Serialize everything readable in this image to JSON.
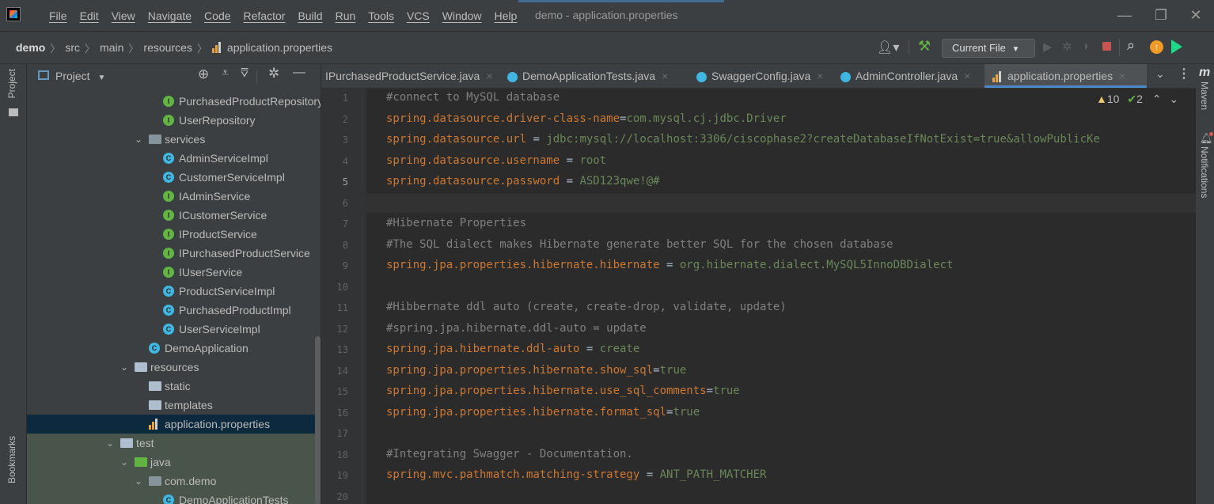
{
  "window": {
    "menu": [
      "File",
      "Edit",
      "View",
      "Navigate",
      "Code",
      "Refactor",
      "Build",
      "Run",
      "Tools",
      "VCS",
      "Window",
      "Help"
    ],
    "title": "demo - application.properties",
    "controls": {
      "minimize": "—",
      "restore": "❐",
      "close": "✕"
    }
  },
  "breadcrumb": [
    "demo",
    "src",
    "main",
    "resources",
    "application.properties"
  ],
  "toolbar": {
    "run_config": "Current File"
  },
  "stripes": {
    "left_top": "Project",
    "left_bottom": "Bookmarks",
    "right_maven": "Maven",
    "right_notifications": "Notifications"
  },
  "project_panel": {
    "title": "Project"
  },
  "tree": [
    {
      "label": "PurchasedProductRepository",
      "kind": "interface",
      "indent": 1
    },
    {
      "label": "UserRepository",
      "kind": "interface",
      "indent": 1
    },
    {
      "label": "services",
      "kind": "package",
      "indent": 0,
      "expanded": true
    },
    {
      "label": "AdminServiceImpl",
      "kind": "class",
      "indent": 1
    },
    {
      "label": "CustomerServiceImpl",
      "kind": "class",
      "indent": 1
    },
    {
      "label": "IAdminService",
      "kind": "interface",
      "indent": 1
    },
    {
      "label": "ICustomerService",
      "kind": "interface",
      "indent": 1
    },
    {
      "label": "IProductService",
      "kind": "interface",
      "indent": 1
    },
    {
      "label": "IPurchasedProductService",
      "kind": "interface",
      "indent": 1
    },
    {
      "label": "IUserService",
      "kind": "interface",
      "indent": 1
    },
    {
      "label": "ProductServiceImpl",
      "kind": "class",
      "indent": 1
    },
    {
      "label": "PurchasedProductImpl",
      "kind": "class",
      "indent": 1
    },
    {
      "label": "UserServiceImpl",
      "kind": "class",
      "indent": 1
    },
    {
      "label": "DemoApplication",
      "kind": "app",
      "indent": 0
    },
    {
      "label": "resources",
      "kind": "resources",
      "indent": -1,
      "expanded": true
    },
    {
      "label": "static",
      "kind": "folder",
      "indent": 0
    },
    {
      "label": "templates",
      "kind": "folder",
      "indent": 0
    },
    {
      "label": "application.properties",
      "kind": "properties",
      "indent": 0,
      "selected": true
    },
    {
      "label": "test",
      "kind": "folder",
      "indent": -2,
      "expanded": true
    },
    {
      "label": "java",
      "kind": "folder-green",
      "indent": -1,
      "expanded": true
    },
    {
      "label": "com.demo",
      "kind": "package",
      "indent": 0,
      "expanded": true
    },
    {
      "label": "DemoApplicationTests",
      "kind": "app",
      "indent": 1
    }
  ],
  "tabs": [
    {
      "label": "IPurchasedProductService.java"
    },
    {
      "label": "DemoApplicationTests.java"
    },
    {
      "label": "SwaggerConfig.java"
    },
    {
      "label": "AdminController.java"
    },
    {
      "label": "application.properties",
      "active": true
    }
  ],
  "inspections": {
    "warnings": "10",
    "weak": "2"
  },
  "editor": {
    "current_line": 5,
    "lines": [
      {
        "n": "1",
        "comment": "#connect to MySQL database"
      },
      {
        "n": "2",
        "key": "spring.datasource.driver-class-name",
        "sep": "=",
        "value": "com.mysql.cj.jdbc.Driver"
      },
      {
        "n": "3",
        "key": "spring.datasource.url",
        "sep": " = ",
        "value": "jdbc:mysql://localhost:3306/ciscophase2?createDatabaseIfNotExist=true&allowPublicKe"
      },
      {
        "n": "4",
        "key": "spring.datasource.username",
        "sep": " = ",
        "value": "root"
      },
      {
        "n": "5",
        "key": "spring.datasource.password",
        "sep": " = ",
        "value": "ASD123qwe!@#"
      },
      {
        "n": "6"
      },
      {
        "n": "7",
        "comment": "#Hibernate Properties"
      },
      {
        "n": "8",
        "comment": "#The SQL dialect makes Hibernate generate better SQL for the chosen database"
      },
      {
        "n": "9",
        "key": "spring.jpa.properties.hibernate.hibernate",
        "sep": " = ",
        "value": "org.hibernate.dialect.MySQL5InnoDBDialect"
      },
      {
        "n": "10"
      },
      {
        "n": "11",
        "comment": "#Hibbernate ddl auto (create, create-drop, validate, update)"
      },
      {
        "n": "12",
        "comment": "#spring.jpa.hibernate.ddl-auto = update"
      },
      {
        "n": "13",
        "key": "spring.jpa.hibernate.ddl-auto",
        "sep": " = ",
        "value": "create"
      },
      {
        "n": "14",
        "key": "spring.jpa.properties.hibernate.show_sql",
        "sep": "=",
        "value": "true"
      },
      {
        "n": "15",
        "key": "spring.jpa.properties.hibernate.use_sql_comments",
        "sep": "=",
        "value": "true"
      },
      {
        "n": "16",
        "key": "spring.jpa.properties.hibernate.format_sql",
        "sep": "=",
        "value": "true"
      },
      {
        "n": "17"
      },
      {
        "n": "18",
        "comment": "#Integrating Swagger - Documentation."
      },
      {
        "n": "19",
        "key": "spring.mvc.pathmatch.matching-strategy",
        "sep": " = ",
        "value": "ANT_PATH_MATCHER"
      },
      {
        "n": "20"
      }
    ]
  }
}
